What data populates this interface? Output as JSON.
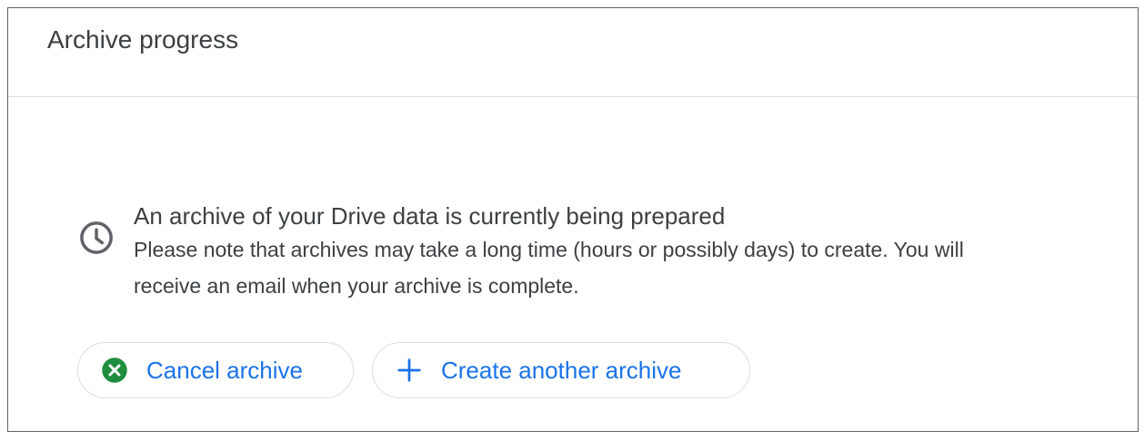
{
  "colors": {
    "accent": "#1a73e8",
    "cancel_icon": "#1e8e3e",
    "text": "#3c4043",
    "divider": "#dadce0"
  },
  "header": {
    "title": "Archive progress"
  },
  "status": {
    "icon": "clock-icon",
    "heading": "An archive of your Drive data is currently being prepared",
    "note_line1": "Please note that archives may take a long time (hours or possibly days) to create. You will",
    "note_line2": "receive an email when your archive is complete."
  },
  "actions": {
    "cancel_label": "Cancel archive",
    "cancel_icon": "cancel-circle-icon",
    "create_label": "Create another archive",
    "create_icon": "plus-icon"
  }
}
